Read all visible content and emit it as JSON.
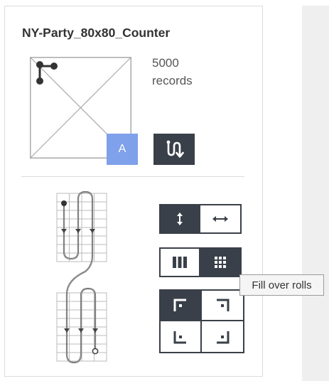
{
  "card": {
    "title": "NY-Party_80x80_Counter",
    "records_count": "5000",
    "records_label": "records",
    "badge_label": "A",
    "route_button_icon": "route-direction-icon"
  },
  "direction_group": [
    {
      "icon": "vertical-arrows-icon",
      "active": true
    },
    {
      "icon": "horizontal-arrows-icon",
      "active": false
    }
  ],
  "fill_group": [
    {
      "icon": "fill-columns-icon",
      "active": false
    },
    {
      "icon": "fill-grid-icon",
      "active": true
    }
  ],
  "corner_group": [
    {
      "icon": "corner-top-left-icon",
      "active": true
    },
    {
      "icon": "corner-top-right-icon",
      "active": false
    },
    {
      "icon": "corner-bottom-left-icon",
      "active": false
    },
    {
      "icon": "corner-bottom-right-icon",
      "active": false
    }
  ],
  "tooltip": {
    "text": "Fill over rolls"
  },
  "colors": {
    "dark": "#3a4049",
    "accent": "#7fa0ea",
    "panel": "#efefef"
  }
}
